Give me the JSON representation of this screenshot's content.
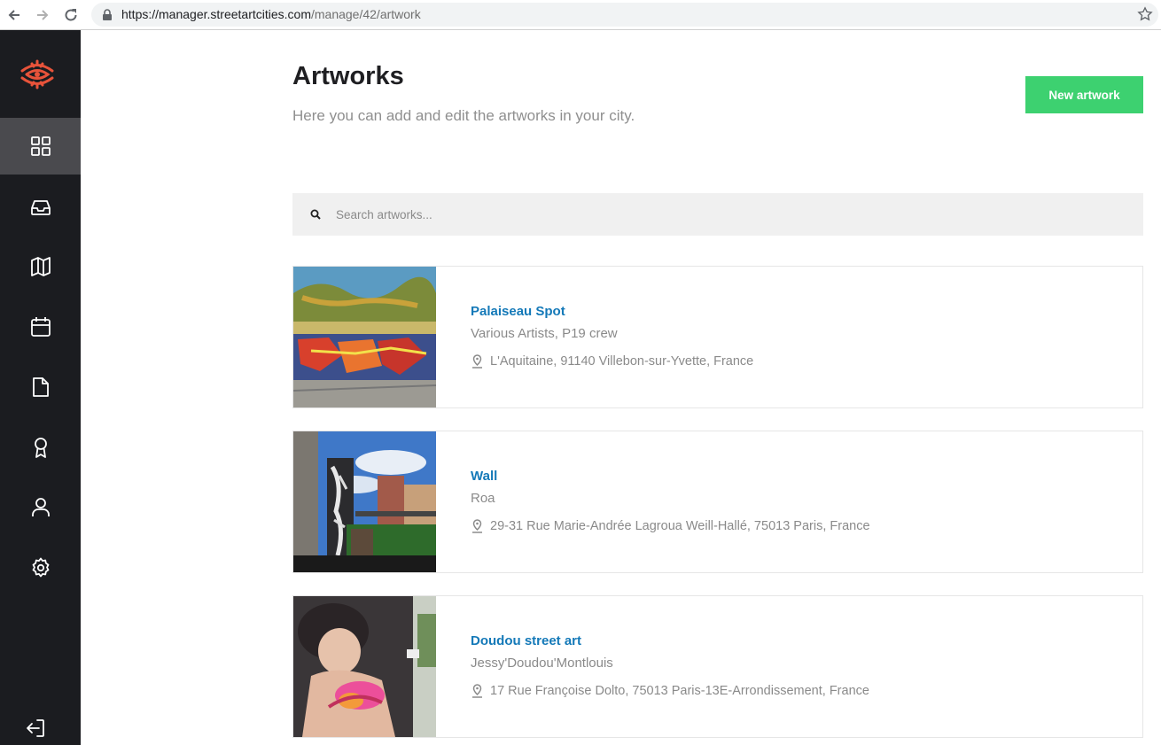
{
  "browser": {
    "url_host": "https://manager.streetartcities.com",
    "url_path": "/manage/42/artwork"
  },
  "sidebar": {
    "items": [
      {
        "icon": "dashboard-icon",
        "active": true
      },
      {
        "icon": "inbox-icon",
        "active": false
      },
      {
        "icon": "map-icon",
        "active": false
      },
      {
        "icon": "calendar-icon",
        "active": false
      },
      {
        "icon": "document-icon",
        "active": false
      },
      {
        "icon": "award-icon",
        "active": false
      },
      {
        "icon": "user-icon",
        "active": false
      },
      {
        "icon": "settings-icon",
        "active": false
      }
    ],
    "logout_icon": "logout-icon"
  },
  "page": {
    "title": "Artworks",
    "subtitle": "Here you can add and edit the artworks in your city.",
    "new_button": "New artwork"
  },
  "search": {
    "placeholder": "Search artworks..."
  },
  "artworks": [
    {
      "name": "Palaiseau Spot",
      "artist": "Various Artists, P19 crew",
      "address": "L'Aquitaine, 91140 Villebon-sur-Yvette, France"
    },
    {
      "name": "Wall",
      "artist": "Roa",
      "address": "29-31 Rue Marie-Andrée Lagroua Weill-Hallé, 75013 Paris, France"
    },
    {
      "name": "Doudou street art",
      "artist": "Jessy'Doudou'Montlouis",
      "address": "17 Rue Françoise Dolto, 75013 Paris-13E-Arrondissement, France"
    }
  ],
  "colors": {
    "sidebar_bg": "#1b1c20",
    "sidebar_active": "#4a4a4e",
    "accent_green": "#3dd170",
    "link_blue": "#1479b8",
    "logo_red": "#e8533a"
  }
}
